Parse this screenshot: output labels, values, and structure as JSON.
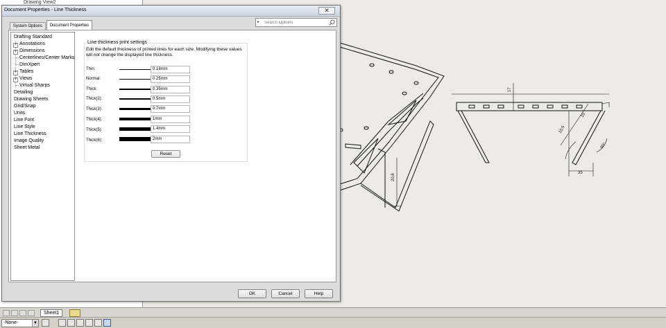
{
  "window": {
    "title": "Document Properties - Line Thickness"
  },
  "background": {
    "tree_stub": "Drawing View2"
  },
  "dialog": {
    "tabs": [
      {
        "label": "System Options",
        "active": false
      },
      {
        "label": "Document Properties",
        "active": true
      }
    ],
    "search": {
      "placeholder": "Search Options"
    },
    "tree": [
      {
        "label": "Drafting Standard",
        "level": 0,
        "expander": ""
      },
      {
        "label": "Annotations",
        "level": 1,
        "expander": "+"
      },
      {
        "label": "Dimensions",
        "level": 1,
        "expander": "+"
      },
      {
        "label": "Centerlines/Center Marks",
        "level": 1,
        "expander": ""
      },
      {
        "label": "DimXpert",
        "level": 1,
        "expander": ""
      },
      {
        "label": "Tables",
        "level": 1,
        "expander": "+"
      },
      {
        "label": "Views",
        "level": 1,
        "expander": "+"
      },
      {
        "label": "Virtual Sharps",
        "level": 1,
        "expander": ""
      },
      {
        "label": "Detailing",
        "level": 0,
        "expander": ""
      },
      {
        "label": "Drawing Sheets",
        "level": 0,
        "expander": ""
      },
      {
        "label": "Grid/Snap",
        "level": 0,
        "expander": ""
      },
      {
        "label": "Units",
        "level": 0,
        "expander": ""
      },
      {
        "label": "Line Font",
        "level": 0,
        "expander": ""
      },
      {
        "label": "Line Style",
        "level": 0,
        "expander": ""
      },
      {
        "label": "Line Thickness",
        "level": 0,
        "expander": "",
        "selected": true
      },
      {
        "label": "Image Quality",
        "level": 0,
        "expander": ""
      },
      {
        "label": "Sheet Metal",
        "level": 0,
        "expander": ""
      }
    ],
    "group": {
      "title": "Line thickness print settings",
      "description": "Edit the default thickness of printed lines for each size.  Modifying these values will not change the displayed line thickness."
    },
    "thickness_rows": [
      {
        "label": "Thin:",
        "value": "0.18mm"
      },
      {
        "label": "Normal:",
        "value": "0.25mm"
      },
      {
        "label": "Thick:",
        "value": "0.35mm"
      },
      {
        "label": "Thick(2):",
        "value": "0.5mm"
      },
      {
        "label": "Thick(3):",
        "value": "0.7mm"
      },
      {
        "label": "Thick(4):",
        "value": "1mm"
      },
      {
        "label": "Thick(5):",
        "value": "1.4mm"
      },
      {
        "label": "Thick(6):",
        "value": "2mm"
      }
    ],
    "reset_label": "Reset",
    "buttons": {
      "ok": "OK",
      "cancel": "Cancel",
      "help": "Help"
    }
  },
  "sheet_tab": "Sheet1",
  "status": {
    "configuration": "-None-"
  },
  "drawing": {
    "dimensions": [
      "17",
      "10",
      "10,5",
      "60°",
      "35",
      "20,6"
    ]
  }
}
